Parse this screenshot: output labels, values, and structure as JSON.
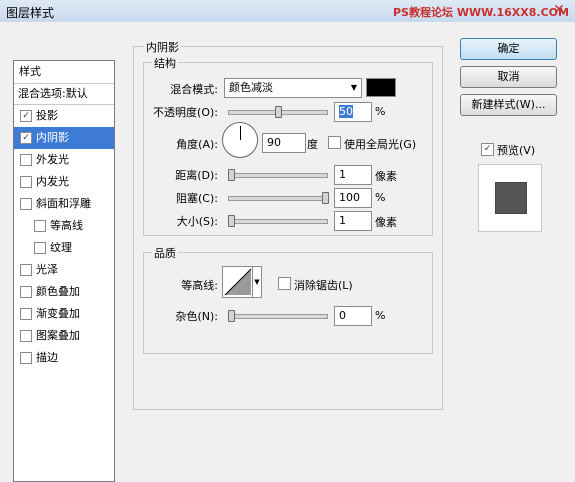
{
  "window": {
    "title": "图层样式",
    "watermark": "PS教程论坛 WWW.16XX8.COM",
    "close": "✕"
  },
  "left_panel": {
    "header": "样式",
    "blend_options": "混合选项:默认",
    "items": [
      {
        "label": "投影",
        "checked": true
      },
      {
        "label": "内阴影",
        "checked": true,
        "selected": true
      },
      {
        "label": "外发光",
        "checked": false
      },
      {
        "label": "内发光",
        "checked": false
      },
      {
        "label": "斜面和浮雕",
        "checked": false
      },
      {
        "label": "等高线",
        "checked": false,
        "sub": true
      },
      {
        "label": "纹理",
        "checked": false,
        "sub": true
      },
      {
        "label": "光泽",
        "checked": false
      },
      {
        "label": "颜色叠加",
        "checked": false
      },
      {
        "label": "渐变叠加",
        "checked": false
      },
      {
        "label": "图案叠加",
        "checked": false
      },
      {
        "label": "描边",
        "checked": false
      }
    ]
  },
  "inner_shadow": {
    "section_title": "内阴影",
    "structure": {
      "title": "结构",
      "blend_mode_label": "混合模式:",
      "blend_mode_value": "颜色减淡",
      "shadow_color": "#000000",
      "opacity_label": "不透明度(O):",
      "opacity_value": "50",
      "opacity_unit": "%",
      "opacity_level": 50,
      "angle_label": "角度(A):",
      "angle_value": "90",
      "angle_unit": "度",
      "global_light_label": "使用全局光(G)",
      "global_light_checked": false,
      "distance_label": "距离(D):",
      "distance_value": "1",
      "distance_unit": "像素",
      "distance_level": 1,
      "choke_label": "阻塞(C):",
      "choke_value": "100",
      "choke_unit": "%",
      "choke_level": 100,
      "size_label": "大小(S):",
      "size_value": "1",
      "size_unit": "像素",
      "size_level": 1
    },
    "quality": {
      "title": "品质",
      "contour_label": "等高线:",
      "anti_alias_label": "消除锯齿(L)",
      "anti_alias_checked": false,
      "noise_label": "杂色(N):",
      "noise_value": "0",
      "noise_unit": "%",
      "noise_level": 0
    }
  },
  "right_panel": {
    "ok": "确定",
    "cancel": "取消",
    "new_style": "新建样式(W)...",
    "preview_label": "预览(V)",
    "preview_checked": true,
    "preview_color": "#555555"
  }
}
